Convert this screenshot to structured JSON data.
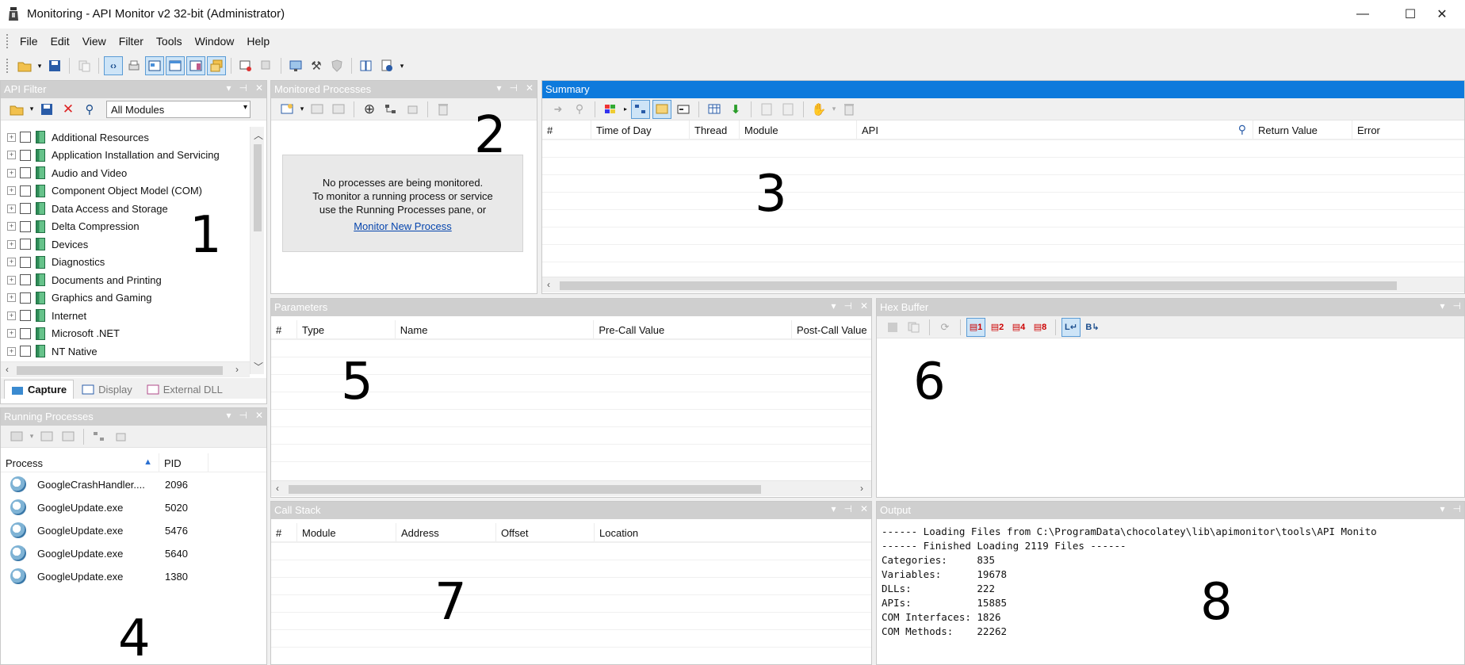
{
  "window": {
    "title": "Monitoring - API Monitor v2 32-bit (Administrator)",
    "minimize": "—",
    "maximize": "☐",
    "close": "✕"
  },
  "menu": [
    "File",
    "Edit",
    "View",
    "Filter",
    "Tools",
    "Window",
    "Help"
  ],
  "api_filter": {
    "title": "API Filter",
    "module_select": "All Modules",
    "categories": [
      "Additional Resources",
      "Application Installation and Servicing",
      "Audio and Video",
      "Component Object Model (COM)",
      "Data Access and Storage",
      "Delta Compression",
      "Devices",
      "Diagnostics",
      "Documents and Printing",
      "Graphics and Gaming",
      "Internet",
      "Microsoft .NET",
      "NT Native"
    ],
    "tabs": [
      "Capture",
      "Display",
      "External DLL"
    ],
    "marker": "1"
  },
  "monitored_processes": {
    "title": "Monitored Processes",
    "message_line1": "No processes are being monitored.",
    "message_line2": "To monitor a running process or service",
    "message_line3": "use the Running Processes pane, or",
    "link": "Monitor New Process",
    "marker": "2"
  },
  "summary": {
    "title": "Summary",
    "columns": [
      "#",
      "Time of Day",
      "Thread",
      "Module",
      "API",
      "Return Value",
      "Error"
    ],
    "marker": "3"
  },
  "running_processes": {
    "title": "Running Processes",
    "columns": [
      "Process",
      "PID"
    ],
    "rows": [
      {
        "name": "GoogleCrashHandler....",
        "pid": "2096"
      },
      {
        "name": "GoogleUpdate.exe",
        "pid": "5020"
      },
      {
        "name": "GoogleUpdate.exe",
        "pid": "5476"
      },
      {
        "name": "GoogleUpdate.exe",
        "pid": "5640"
      },
      {
        "name": "GoogleUpdate.exe",
        "pid": "1380"
      }
    ],
    "marker": "4"
  },
  "parameters": {
    "title": "Parameters",
    "columns": [
      "#",
      "Type",
      "Name",
      "Pre-Call Value",
      "Post-Call Value"
    ],
    "marker": "5"
  },
  "hex_buffer": {
    "title": "Hex Buffer",
    "marker": "6"
  },
  "call_stack": {
    "title": "Call Stack",
    "columns": [
      "#",
      "Module",
      "Address",
      "Offset",
      "Location"
    ],
    "marker": "7"
  },
  "output": {
    "title": "Output",
    "lines": [
      "------ Loading Files from C:\\ProgramData\\chocolatey\\lib\\apimonitor\\tools\\API Monito",
      "------ Finished Loading 2119 Files ------",
      "Categories:     835",
      "Variables:      19678",
      "DLLs:           222",
      "APIs:           15885",
      "COM Interfaces: 1826",
      "COM Methods:    22262"
    ],
    "marker": "8"
  }
}
